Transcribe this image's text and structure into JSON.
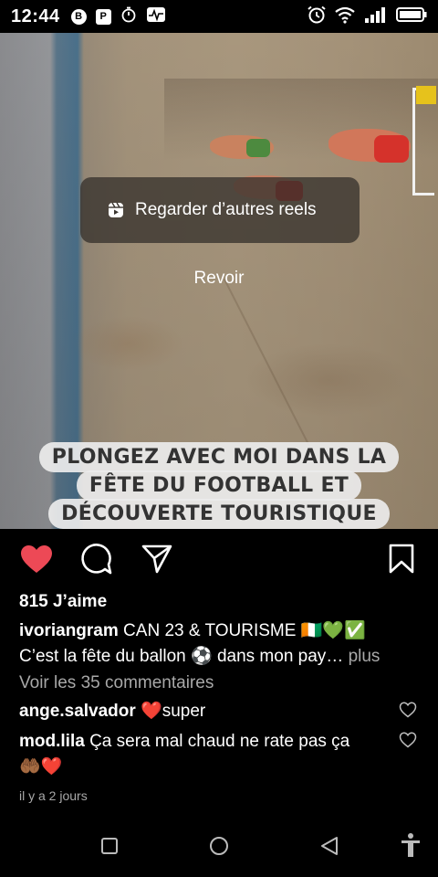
{
  "status_bar": {
    "time": "12:44",
    "left_icons": [
      "b-badge-icon",
      "p-square-icon",
      "stopwatch-icon",
      "activity-icon"
    ],
    "right_icons": [
      "alarm-icon",
      "wifi-icon",
      "signal-icon",
      "battery-icon"
    ],
    "b_badge": "B",
    "p_square": "P"
  },
  "video": {
    "reels_button_label": "Regarder d’autres reels",
    "rewatch_label": "Revoir",
    "caption_lines": [
      "PLONGEZ AVEC MOI DANS  LA",
      "FÊTE DU FOOTBALL ET",
      "DÉCOUVERTE TOURISTIQUE"
    ]
  },
  "actions": {
    "liked": true,
    "like_color": "#ed4956",
    "icons": [
      "heart-icon",
      "comment-icon",
      "share-icon",
      "bookmark-icon"
    ]
  },
  "post": {
    "likes": "815 J’aime",
    "username": "ivoriangram",
    "caption_line1": " CAN 23 & TOURISME 🇨🇮💚✅",
    "caption_line2": "C’est la fête du ballon ⚽ dans mon pay…",
    "more_label": " plus",
    "view_comments": "Voir les 35 commentaires",
    "timestamp": "il y a 2 jours"
  },
  "comments": [
    {
      "username": "ange.salvador",
      "text": " ❤️super"
    },
    {
      "username": "mod.lila",
      "text": " Ça sera mal  chaud ne rate pas ça",
      "text_line2": "🤲🏾❤️"
    }
  ],
  "nav_bar": {
    "buttons": [
      "recents-square-icon",
      "home-circle-icon",
      "back-triangle-icon",
      "accessibility-icon"
    ]
  }
}
